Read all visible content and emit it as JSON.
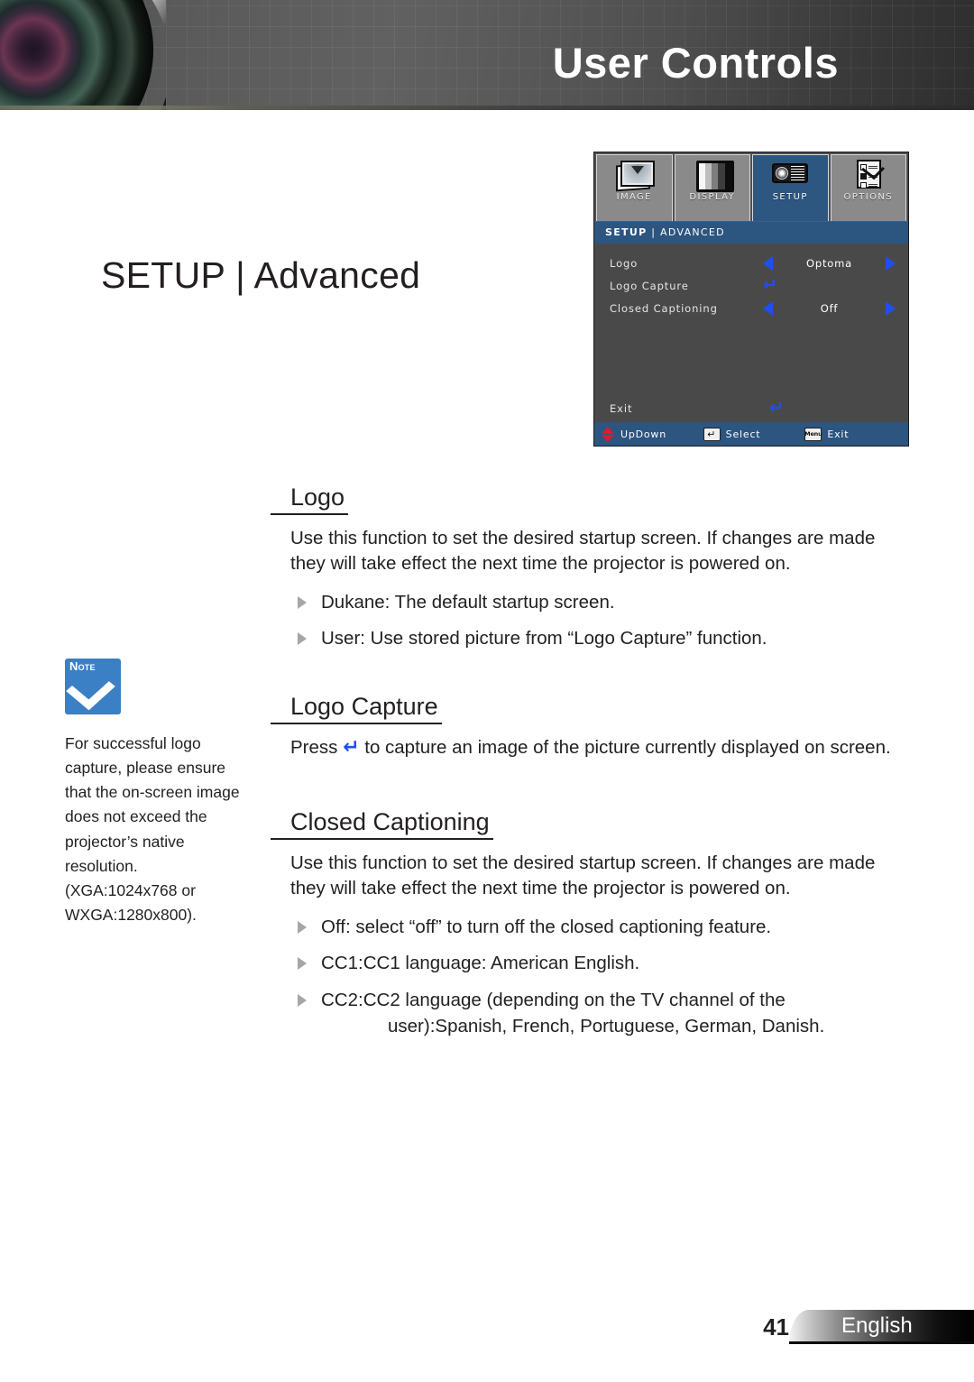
{
  "header": {
    "title": "User Controls",
    "lens_photo_alt": "camera-lens"
  },
  "page_title": "SETUP | Advanced",
  "osd": {
    "tabs": [
      {
        "label": "IMAGE",
        "icon": "image-icon",
        "selected": false
      },
      {
        "label": "DISPLAY",
        "icon": "display-icon",
        "selected": false
      },
      {
        "label": "SETUP",
        "icon": "projector-icon",
        "selected": true
      },
      {
        "label": "OPTIONS",
        "icon": "checklist-icon",
        "selected": false
      }
    ],
    "subheader_main": "SETUP",
    "subheader_sep": " | ",
    "subheader_sub": "ADVANCED",
    "rows": [
      {
        "label": "Logo",
        "value": "Optoma",
        "control": "arrows"
      },
      {
        "label": "Logo Capture",
        "value": "",
        "control": "enter"
      },
      {
        "label": "Closed Captioning",
        "value": "Off",
        "control": "arrows"
      }
    ],
    "exit_label": "Exit",
    "exit_symbol": "↵",
    "footer": [
      {
        "label": "UpDown",
        "icon": "updown-arrows-icon"
      },
      {
        "label": "Select",
        "icon": "enter-key-icon",
        "key": "↵"
      },
      {
        "label": "Exit",
        "icon": "menu-key-icon",
        "key": "Menu"
      }
    ],
    "colors": {
      "panel_bg": "#494949",
      "header_blue": "#2c5580",
      "arrow_blue": "#1f4fef",
      "updown_red": "#e0192c",
      "tab_inactive": "#8a8a8a"
    }
  },
  "sections": [
    {
      "heading": "Logo",
      "paragraph": "Use this function to set the desired startup screen. If changes are made they will take effect the next time the projector is powered on.",
      "bullets": [
        {
          "text": "Dukane: The default startup screen."
        },
        {
          "text": "User: Use stored picture from “Logo Capture” function."
        }
      ]
    },
    {
      "heading": "Logo Capture",
      "paragraph_pre": "Press ",
      "paragraph_symbol": "↵",
      "paragraph_post": " to capture an image of the picture currently displayed on screen.",
      "bullets": []
    },
    {
      "heading": "Closed Captioning",
      "paragraph": "Use this function to set the desired startup screen. If changes are made they will take effect the next time the projector is powered on.",
      "bullets": [
        {
          "text": "Off: select “off” to turn off the closed captioning feature."
        },
        {
          "text": "CC1:CC1 language: American English."
        },
        {
          "text": "CC2:CC2 language (depending on the TV channel of the",
          "continuation": "user):Spanish, French, Portuguese, German, Danish."
        }
      ]
    }
  ],
  "note": {
    "badge_label_n": "N",
    "badge_label_ote": "OTE",
    "icon": "note-check-icon",
    "text": "For successful logo capture, please ensure that the on-screen image does not exceed the projector’s native resolution. (XGA:1024x768 or WXGA:1280x800).",
    "accent_color": "#3b7fc4"
  },
  "footer": {
    "page_number": "41",
    "language": "English"
  }
}
